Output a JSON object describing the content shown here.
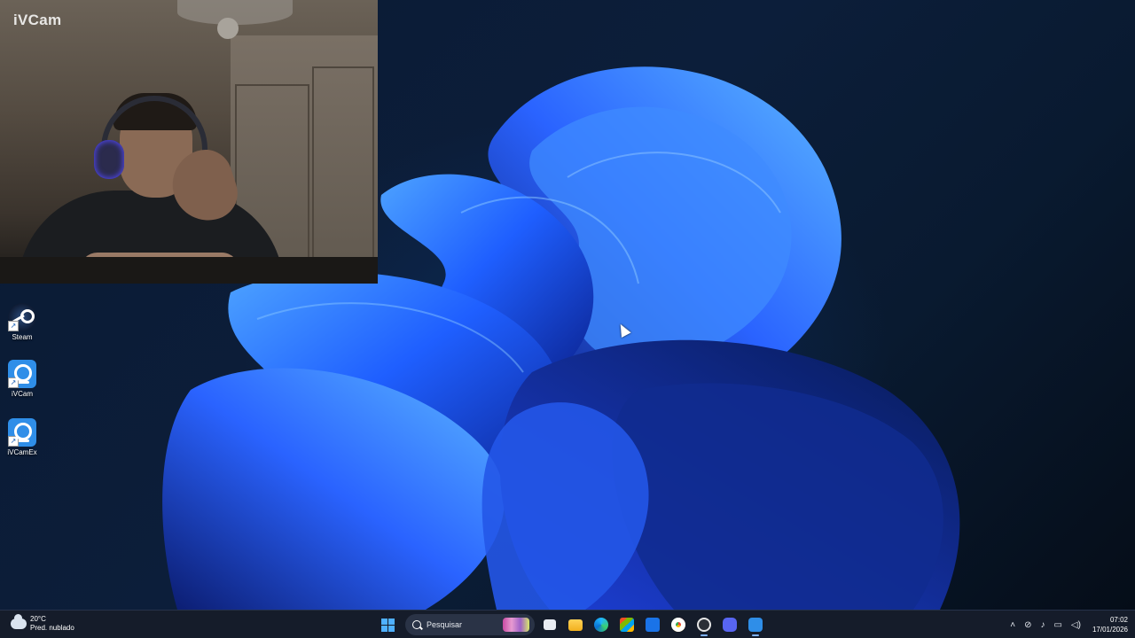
{
  "webcam": {
    "label": "iVCam"
  },
  "desktop_icons": [
    {
      "label": "Steam",
      "icon": "steam-icon"
    },
    {
      "label": "iVCam",
      "icon": "ivcam-icon"
    },
    {
      "label": "iVCamEx",
      "icon": "ivcamex-icon"
    }
  ],
  "taskbar": {
    "weather": {
      "temp": "20°C",
      "condition": "Pred. nublado"
    },
    "search_placeholder": "Pesquisar",
    "pinned_apps": [
      "start",
      "search",
      "task-view",
      "file-explorer",
      "edge",
      "microsoft-store",
      "mail",
      "chrome",
      "obs",
      "discord",
      "ivcam"
    ],
    "clock": {
      "time": "07:02",
      "date": "17/01/2026"
    }
  },
  "colors": {
    "accent": "#2f8ee8",
    "taskbar": "#151c2a",
    "wallpaper_bloom": "#1e5cff"
  }
}
